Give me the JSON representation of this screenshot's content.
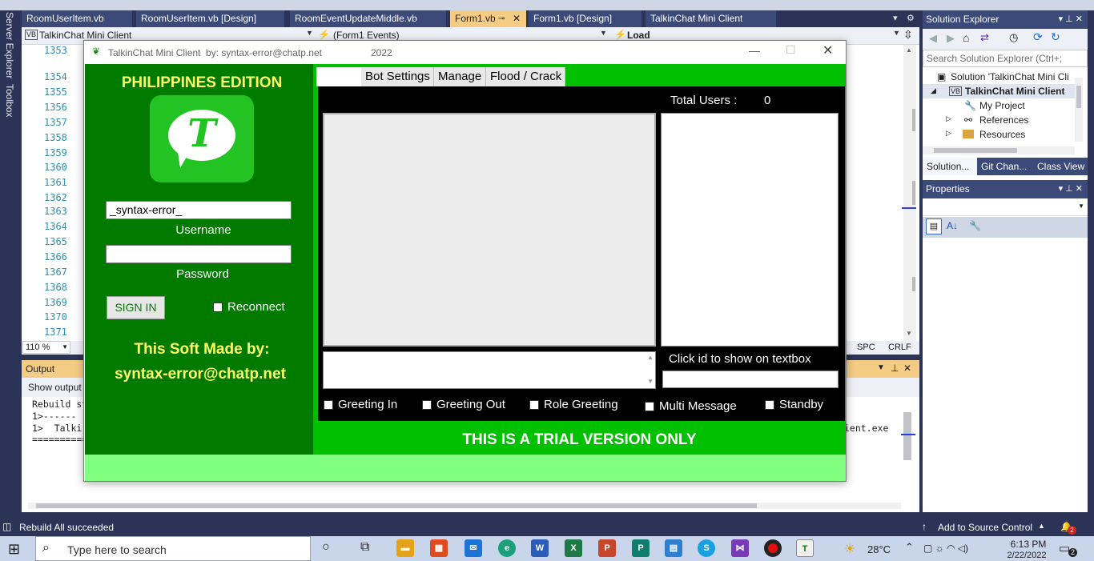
{
  "vs": {
    "doc_tabs": [
      "RoomUserItem.vb",
      "RoomUserItem.vb [Design]",
      "RoomEventUpdateMiddle.vb",
      "Form1.vb",
      "Form1.vb [Design]",
      "TalkinChat Mini Client"
    ],
    "nav": {
      "project": "TalkinChat Mini Client",
      "object": "(Form1 Events)",
      "member": "Load"
    },
    "line_numbers": [
      "1353",
      "1354",
      "1355",
      "1356",
      "1357",
      "1358",
      "1359",
      "1360",
      "1361",
      "1362",
      "1363",
      "1364",
      "1365",
      "1366",
      "1367",
      "1368",
      "1369",
      "1370",
      "1371"
    ],
    "zoom": "110 %",
    "spc": "SPC",
    "crlf": "CRLF",
    "side_rail": {
      "server_explorer": "Server Explorer",
      "toolbox": "Toolbox"
    },
    "output": {
      "title": "Output",
      "show_from": "Show output",
      "lines": [
        "Rebuild st",
        "1>------ ",
        "1>  Talki",
        "=========="
      ],
      "tail": "ient.exe"
    },
    "solution_explorer": {
      "title": "Solution Explorer",
      "search_placeholder": "Search Solution Explorer (Ctrl+;",
      "tree": [
        "Solution 'TalkinChat Mini Cli",
        "TalkinChat Mini Client",
        "My Project",
        "References",
        "Resources"
      ],
      "bottom_tabs": [
        "Solution...",
        "Git Chan...",
        "Class View"
      ]
    },
    "properties": {
      "title": "Properties"
    },
    "status": {
      "message": "Rebuild All succeeded",
      "source_control": "Add to Source Control",
      "notifications": "2"
    }
  },
  "taskbar": {
    "search_placeholder": "Type here to search",
    "weather": "28°C",
    "time": "6:13 PM",
    "date": "2/22/2022",
    "notification_count": "2"
  },
  "app": {
    "title": "TalkinChat Mini Client  by: syntax-error@chatp.net",
    "year": "2022",
    "edition": "PHILIPPINES EDITION",
    "logo_letter": "T",
    "username_value": "_syntax-error_",
    "username_label": "Username",
    "password_value": "",
    "password_label": "Password",
    "sign_in": "SIGN IN",
    "reconnect": "Reconnect",
    "credit_line1": "This Soft Made by:",
    "credit_line2": "syntax-error@chatp.net",
    "tabs": [
      "",
      "Bot Settings",
      "Manage",
      "Flood / Crack"
    ],
    "total_users_label": "Total Users :",
    "total_users_value": "0",
    "click_id_hint": "Click id to show on textbox",
    "options": [
      "Greeting In",
      "Greeting Out",
      "Role Greeting",
      "Multi Message",
      "Standby"
    ],
    "trial_notice": "THIS IS A TRIAL VERSION ONLY",
    "colors": {
      "dark_green": "#007b00",
      "green": "#00c000",
      "light_green": "#80ff80",
      "yellow": "#ffff66"
    }
  }
}
